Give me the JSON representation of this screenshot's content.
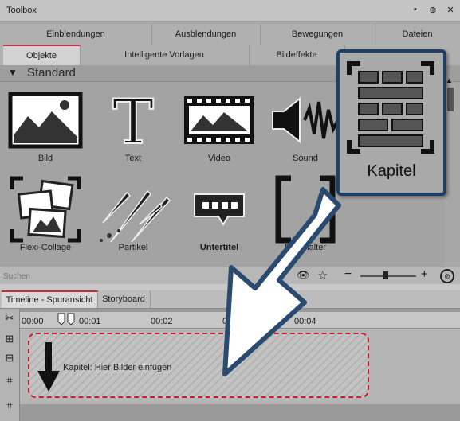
{
  "window": {
    "title": "Toolbox",
    "buttons": [
      "▪",
      "⊕",
      "✕"
    ]
  },
  "tabs_row1": [
    "Einblendungen",
    "Ausblendungen",
    "Bewegungen",
    "Dateien"
  ],
  "tabs_row2": [
    "Objekte",
    "Intelligente Vorlagen",
    "Bildeffekte",
    ""
  ],
  "section": {
    "arrow": "▼",
    "label": "Standard"
  },
  "objects": [
    {
      "label": "Bild",
      "icon": "image-icon",
      "bold": false
    },
    {
      "label": "Text",
      "icon": "text-icon",
      "bold": false
    },
    {
      "label": "Video",
      "icon": "video-film-icon",
      "bold": false
    },
    {
      "label": "Sound",
      "icon": "sound-speaker-icon",
      "bold": false
    },
    {
      "label": "Flexi-Collage",
      "icon": "collage-icon",
      "bold": false
    },
    {
      "label": "Partikel",
      "icon": "particle-icon",
      "bold": false
    },
    {
      "label": "Untertitel",
      "icon": "subtitle-icon",
      "bold": true
    },
    {
      "label": "Platzhalter",
      "icon": "placeholder-icon",
      "bold": false
    }
  ],
  "highlight": {
    "label": "Kapitel",
    "icon": "chapter-icon"
  },
  "search": {
    "placeholder": "Suchen",
    "eye_icon": "eye-icon",
    "star_icon": "star-icon",
    "minus": "−",
    "plus": "+",
    "zoom_fit_icon": "zoom-fit-icon",
    "zoom_level": 0.45
  },
  "timeline_tabs": [
    "Timeline - Spuransicht",
    "Storyboard"
  ],
  "ruler": {
    "ticks": [
      "00:00",
      "00:01",
      "00:02",
      "00:03",
      "00:04"
    ]
  },
  "chapter_track": {
    "text": "Kapitel: Hier Bilder einfügen"
  },
  "colors": {
    "accent": "#c0303a",
    "popup_border": "#1e3f66",
    "arrow_fill": "#ffffff",
    "arrow_stroke": "#2a4a70"
  }
}
